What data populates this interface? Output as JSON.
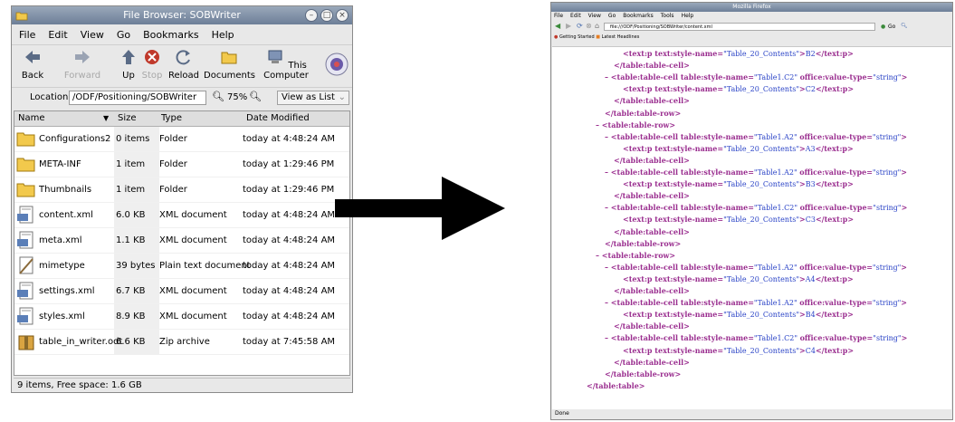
{
  "file_browser": {
    "title": "File Browser: SOBWriter",
    "menu": [
      "File",
      "Edit",
      "View",
      "Go",
      "Bookmarks",
      "Help"
    ],
    "toolbar": {
      "back": "Back",
      "forward": "Forward",
      "up": "Up",
      "stop": "Stop",
      "reload": "Reload",
      "documents": "Documents",
      "this_computer": "This Computer"
    },
    "location_label": "Location:",
    "location_value": "/ODF/Positioning/SOBWriter",
    "zoom": "75%",
    "view_as": "View as List",
    "columns": {
      "name": "Name",
      "size": "Size",
      "type": "Type",
      "date": "Date Modified"
    },
    "files": [
      {
        "name": "Configurations2",
        "size": "0 items",
        "type": "Folder",
        "date": "today at 4:48:24 AM",
        "icon": "folder-icon"
      },
      {
        "name": "META-INF",
        "size": "1 item",
        "type": "Folder",
        "date": "today at 1:29:46 PM",
        "icon": "folder-icon"
      },
      {
        "name": "Thumbnails",
        "size": "1 item",
        "type": "Folder",
        "date": "today at 1:29:46 PM",
        "icon": "folder-icon"
      },
      {
        "name": "content.xml",
        "size": "6.0 KB",
        "type": "XML document",
        "date": "today at 4:48:24 AM",
        "icon": "xml-file-icon"
      },
      {
        "name": "meta.xml",
        "size": "1.1 KB",
        "type": "XML document",
        "date": "today at 4:48:24 AM",
        "icon": "xml-file-icon"
      },
      {
        "name": "mimetype",
        "size": "39 bytes",
        "type": "Plain text document",
        "date": "today at 4:48:24 AM",
        "icon": "text-file-icon"
      },
      {
        "name": "settings.xml",
        "size": "6.7 KB",
        "type": "XML document",
        "date": "today at 4:48:24 AM",
        "icon": "xml-file-icon"
      },
      {
        "name": "styles.xml",
        "size": "8.9 KB",
        "type": "XML document",
        "date": "today at 4:48:24 AM",
        "icon": "xml-file-icon"
      },
      {
        "name": "table_in_writer.odt",
        "size": "6.6 KB",
        "type": "Zip archive",
        "date": "today at 7:45:58 AM",
        "icon": "archive-icon"
      }
    ],
    "status": "9 items, Free space: 1.6 GB"
  },
  "browser": {
    "title": "Mozilla Firefox",
    "menu": [
      "File",
      "Edit",
      "View",
      "Go",
      "Bookmarks",
      "Tools",
      "Help"
    ],
    "url": "file:///ODF/Positioning/SOBWriter/content.xml",
    "go_label": "Go",
    "bookmarks": [
      "Getting Started",
      "Latest Headlines"
    ],
    "status": "Done",
    "xml_lines": [
      {
        "indent": 30,
        "parts": [
          [
            "t",
            "<text:p "
          ],
          [
            "m",
            "text:style-name="
          ],
          [
            "v",
            "\"Table_20_Contents\""
          ],
          [
            "t",
            ">"
          ],
          [
            "v",
            "B2"
          ],
          [
            "t",
            "</text:p>"
          ]
        ]
      },
      {
        "indent": 20,
        "parts": [
          [
            "t",
            "</table:table-cell>"
          ]
        ]
      },
      {
        "indent": 10,
        "parts": [
          [
            "m",
            "– "
          ],
          [
            "t",
            "<table:table-cell "
          ],
          [
            "m",
            "table:style-name="
          ],
          [
            "v",
            "\"Table1.C2\" "
          ],
          [
            "m",
            "office:value-type="
          ],
          [
            "v",
            "\"string\""
          ],
          [
            "t",
            ">"
          ]
        ]
      },
      {
        "indent": 30,
        "parts": [
          [
            "t",
            "<text:p "
          ],
          [
            "m",
            "text:style-name="
          ],
          [
            "v",
            "\"Table_20_Contents\""
          ],
          [
            "t",
            ">"
          ],
          [
            "v",
            "C2"
          ],
          [
            "t",
            "</text:p>"
          ]
        ]
      },
      {
        "indent": 20,
        "parts": [
          [
            "t",
            "</table:table-cell>"
          ]
        ]
      },
      {
        "indent": 10,
        "parts": [
          [
            "t",
            "</table:table-row>"
          ]
        ]
      },
      {
        "indent": 0,
        "parts": [
          [
            "m",
            "– "
          ],
          [
            "t",
            "<table:table-row>"
          ]
        ]
      },
      {
        "indent": 10,
        "parts": [
          [
            "m",
            "– "
          ],
          [
            "t",
            "<table:table-cell "
          ],
          [
            "m",
            "table:style-name="
          ],
          [
            "v",
            "\"Table1.A2\" "
          ],
          [
            "m",
            "office:value-type="
          ],
          [
            "v",
            "\"string\""
          ],
          [
            "t",
            ">"
          ]
        ]
      },
      {
        "indent": 30,
        "parts": [
          [
            "t",
            "<text:p "
          ],
          [
            "m",
            "text:style-name="
          ],
          [
            "v",
            "\"Table_20_Contents\""
          ],
          [
            "t",
            ">"
          ],
          [
            "v",
            "A3"
          ],
          [
            "t",
            "</text:p>"
          ]
        ]
      },
      {
        "indent": 20,
        "parts": [
          [
            "t",
            "</table:table-cell>"
          ]
        ]
      },
      {
        "indent": 10,
        "parts": [
          [
            "m",
            "– "
          ],
          [
            "t",
            "<table:table-cell "
          ],
          [
            "m",
            "table:style-name="
          ],
          [
            "v",
            "\"Table1.A2\" "
          ],
          [
            "m",
            "office:value-type="
          ],
          [
            "v",
            "\"string\""
          ],
          [
            "t",
            ">"
          ]
        ]
      },
      {
        "indent": 30,
        "parts": [
          [
            "t",
            "<text:p "
          ],
          [
            "m",
            "text:style-name="
          ],
          [
            "v",
            "\"Table_20_Contents\""
          ],
          [
            "t",
            ">"
          ],
          [
            "v",
            "B3"
          ],
          [
            "t",
            "</text:p>"
          ]
        ]
      },
      {
        "indent": 20,
        "parts": [
          [
            "t",
            "</table:table-cell>"
          ]
        ]
      },
      {
        "indent": 10,
        "parts": [
          [
            "m",
            "– "
          ],
          [
            "t",
            "<table:table-cell "
          ],
          [
            "m",
            "table:style-name="
          ],
          [
            "v",
            "\"Table1.C2\" "
          ],
          [
            "m",
            "office:value-type="
          ],
          [
            "v",
            "\"string\""
          ],
          [
            "t",
            ">"
          ]
        ]
      },
      {
        "indent": 30,
        "parts": [
          [
            "t",
            "<text:p "
          ],
          [
            "m",
            "text:style-name="
          ],
          [
            "v",
            "\"Table_20_Contents\""
          ],
          [
            "t",
            ">"
          ],
          [
            "v",
            "C3"
          ],
          [
            "t",
            "</text:p>"
          ]
        ]
      },
      {
        "indent": 20,
        "parts": [
          [
            "t",
            "</table:table-cell>"
          ]
        ]
      },
      {
        "indent": 10,
        "parts": [
          [
            "t",
            "</table:table-row>"
          ]
        ]
      },
      {
        "indent": 0,
        "parts": [
          [
            "m",
            "– "
          ],
          [
            "t",
            "<table:table-row>"
          ]
        ]
      },
      {
        "indent": 10,
        "parts": [
          [
            "m",
            "– "
          ],
          [
            "t",
            "<table:table-cell "
          ],
          [
            "m",
            "table:style-name="
          ],
          [
            "v",
            "\"Table1.A2\" "
          ],
          [
            "m",
            "office:value-type="
          ],
          [
            "v",
            "\"string\""
          ],
          [
            "t",
            ">"
          ]
        ]
      },
      {
        "indent": 30,
        "parts": [
          [
            "t",
            "<text:p "
          ],
          [
            "m",
            "text:style-name="
          ],
          [
            "v",
            "\"Table_20_Contents\""
          ],
          [
            "t",
            ">"
          ],
          [
            "v",
            "A4"
          ],
          [
            "t",
            "</text:p>"
          ]
        ]
      },
      {
        "indent": 20,
        "parts": [
          [
            "t",
            "</table:table-cell>"
          ]
        ]
      },
      {
        "indent": 10,
        "parts": [
          [
            "m",
            "– "
          ],
          [
            "t",
            "<table:table-cell "
          ],
          [
            "m",
            "table:style-name="
          ],
          [
            "v",
            "\"Table1.A2\" "
          ],
          [
            "m",
            "office:value-type="
          ],
          [
            "v",
            "\"string\""
          ],
          [
            "t",
            ">"
          ]
        ]
      },
      {
        "indent": 30,
        "parts": [
          [
            "t",
            "<text:p "
          ],
          [
            "m",
            "text:style-name="
          ],
          [
            "v",
            "\"Table_20_Contents\""
          ],
          [
            "t",
            ">"
          ],
          [
            "v",
            "B4"
          ],
          [
            "t",
            "</text:p>"
          ]
        ]
      },
      {
        "indent": 20,
        "parts": [
          [
            "t",
            "</table:table-cell>"
          ]
        ]
      },
      {
        "indent": 10,
        "parts": [
          [
            "m",
            "– "
          ],
          [
            "t",
            "<table:table-cell "
          ],
          [
            "m",
            "table:style-name="
          ],
          [
            "v",
            "\"Table1.C2\" "
          ],
          [
            "m",
            "office:value-type="
          ],
          [
            "v",
            "\"string\""
          ],
          [
            "t",
            ">"
          ]
        ]
      },
      {
        "indent": 30,
        "parts": [
          [
            "t",
            "<text:p "
          ],
          [
            "m",
            "text:style-name="
          ],
          [
            "v",
            "\"Table_20_Contents\""
          ],
          [
            "t",
            ">"
          ],
          [
            "v",
            "C4"
          ],
          [
            "t",
            "</text:p>"
          ]
        ]
      },
      {
        "indent": 20,
        "parts": [
          [
            "t",
            "</table:table-cell>"
          ]
        ]
      },
      {
        "indent": 10,
        "parts": [
          [
            "t",
            "</table:table-row>"
          ]
        ]
      },
      {
        "indent": -10,
        "parts": [
          [
            "t",
            "</table:table>"
          ]
        ]
      }
    ]
  }
}
